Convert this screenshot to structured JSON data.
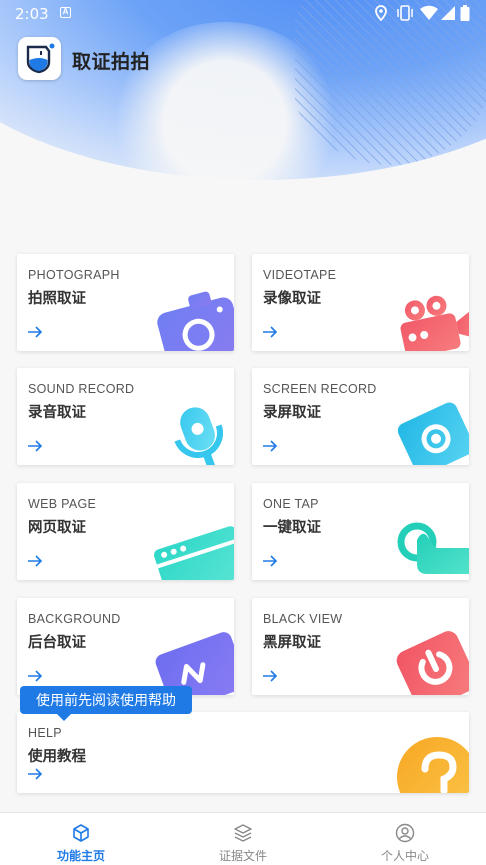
{
  "status_bar": {
    "time": "2:03",
    "notification_icon_letter": "A",
    "icons": [
      "location-icon",
      "vibrate-icon",
      "wifi-icon",
      "signal-icon",
      "battery-icon"
    ]
  },
  "app": {
    "title": "取证拍拍",
    "logo_icon": "shield-camera-logo"
  },
  "colors": {
    "accent": "#1f7ae6",
    "header_blue": "#4f8df5"
  },
  "cards": [
    {
      "en": "PHOTOGRAPH",
      "zh": "拍照取证",
      "icon": "camera-icon"
    },
    {
      "en": "VIDEOTAPE",
      "zh": "录像取证",
      "icon": "video-camera-icon"
    },
    {
      "en": "SOUND RECORD",
      "zh": "录音取证",
      "icon": "microphone-icon"
    },
    {
      "en": "SCREEN RECORD",
      "zh": "录屏取证",
      "icon": "screen-record-icon"
    },
    {
      "en": "WEB PAGE",
      "zh": "网页取证",
      "icon": "browser-window-icon"
    },
    {
      "en": "ONE TAP",
      "zh": "一键取证",
      "icon": "tap-hand-icon"
    },
    {
      "en": "BACKGROUND",
      "zh": "后台取证",
      "icon": "background-wave-icon"
    },
    {
      "en": "BLACK VIEW",
      "zh": "黑屏取证",
      "icon": "power-icon"
    },
    {
      "en": "HELP",
      "zh": "使用教程",
      "icon": "help-question-icon"
    }
  ],
  "tooltip": "使用前先阅读使用帮助",
  "bottom_nav": [
    {
      "label": "功能主页",
      "icon": "cube-icon",
      "active": true
    },
    {
      "label": "证据文件",
      "icon": "layers-icon",
      "active": false
    },
    {
      "label": "个人中心",
      "icon": "user-circle-icon",
      "active": false
    }
  ]
}
